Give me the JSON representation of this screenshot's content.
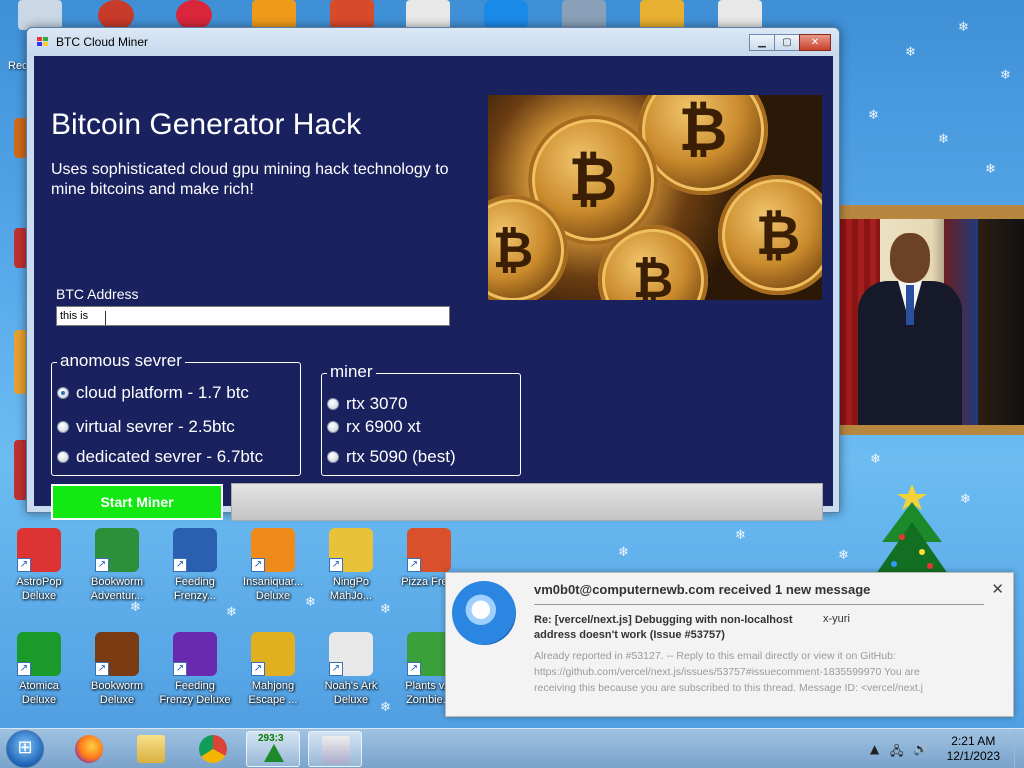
{
  "window": {
    "title": "BTC Cloud Miner",
    "heading": "Bitcoin Generator Hack",
    "subtitle": "Uses sophisticated cloud gpu mining hack technology to mine bitcoins and make rich!",
    "address_label": "BTC Address",
    "address_value": "this is",
    "server_group": {
      "label": "anomous sevrer",
      "options": [
        "cloud platform - 1.7 btc",
        "virtual sevrer - 2.5btc",
        "dedicated sevrer - 6.7btc"
      ],
      "selected": 0
    },
    "miner_group": {
      "label": "miner",
      "options": [
        "rtx 3070",
        "rx 6900 xt",
        "rtx 5090 (best)"
      ],
      "selected": -1
    },
    "start_button": "Start Miner",
    "progress": 0
  },
  "desktop_icons": [
    {
      "label": "AstroPop Deluxe",
      "line2": "Deluxe",
      "line1": "AstroPop",
      "icon": "astropop-icon",
      "color": "#d33"
    },
    {
      "label": "Bookworm Adventur...",
      "line1": "Bookworm",
      "line2": "Adventur...",
      "icon": "bookworm-adventures-icon",
      "color": "#2c8f3a"
    },
    {
      "label": "Feeding Frenzy...",
      "line1": "Feeding",
      "line2": "Frenzy...",
      "icon": "feeding-frenzy-icon",
      "color": "#2b5fb0"
    },
    {
      "label": "Insaniquar... Deluxe",
      "line1": "Insaniquar...",
      "line2": "Deluxe",
      "icon": "insaniquarium-icon",
      "color": "#f08a1a"
    },
    {
      "label": "NingPo MahJo...",
      "line1": "NingPo",
      "line2": "MahJo...",
      "icon": "ningpo-mahjong-icon",
      "color": "#e8c33a"
    },
    {
      "label": "Pizza Fren...",
      "line1": "Pizza Fre...",
      "line2": "",
      "icon": "pizza-frenzy-icon",
      "color": "#d9502b"
    },
    {
      "label": "Atomica Deluxe",
      "line1": "Atomica",
      "line2": "Deluxe",
      "icon": "atomica-icon",
      "color": "#1a9a2a"
    },
    {
      "label": "Bookworm Deluxe",
      "line1": "Bookworm",
      "line2": "Deluxe",
      "icon": "bookworm-deluxe-icon",
      "color": "#7a3b12"
    },
    {
      "label": "Feeding Frenzy Deluxe",
      "line1": "Feeding",
      "line2": "Frenzy Deluxe",
      "icon": "feeding-frenzy-deluxe-icon",
      "color": "#6a2ab0"
    },
    {
      "label": "Mahjong Escape ...",
      "line1": "Mahjong",
      "line2": "Escape ...",
      "icon": "mahjong-escape-icon",
      "color": "#e0b020"
    },
    {
      "label": "Noah's Ark Deluxe",
      "line1": "Noah's Ark",
      "line2": "Deluxe",
      "icon": "noahs-ark-icon",
      "color": "#e8e8e8"
    },
    {
      "label": "Plants vs Zombies",
      "line1": "Plants v...",
      "line2": "Zombie...",
      "icon": "plants-vs-zombies-icon",
      "color": "#3aa03a"
    }
  ],
  "notification": {
    "sender": "vm0b0t@computernewb.com received 1 new message",
    "subject": "Re: [vercel/next.js] Debugging with non-localhost address doesn't work (Issue #53757)",
    "from": "x-yuri",
    "body_lines": [
      "Already reported in #53127. -- Reply to this email directly or view it on GitHub:",
      "https://github.com/vercel/next.js/issues/53757#issuecomment-1835599970 You are",
      "receiving this because you are subscribed to this thread. Message ID: <vercel/next.j"
    ]
  },
  "taskbar": {
    "counter": "293:3",
    "time": "2:21 AM",
    "date": "12/1/2023"
  },
  "colors": {
    "client_bg": "#19225f",
    "start_green": "#12e812"
  }
}
